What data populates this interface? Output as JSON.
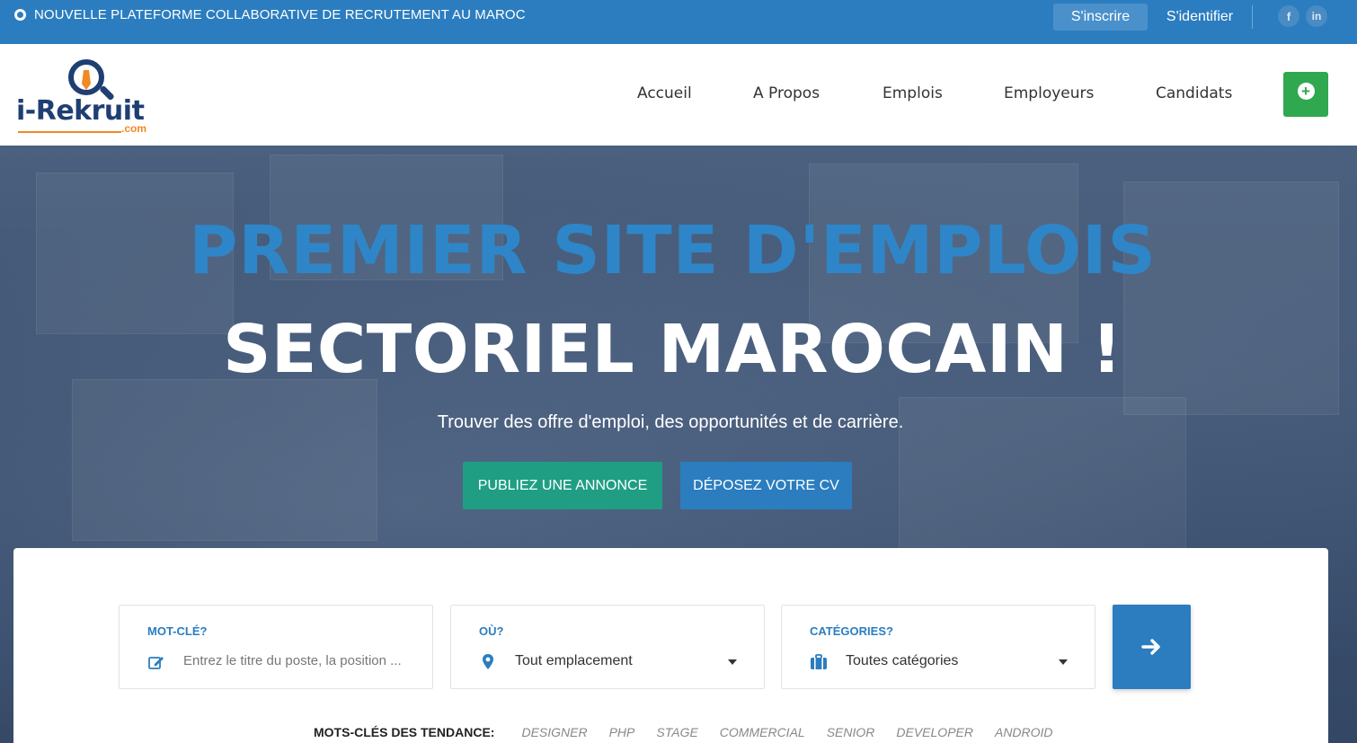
{
  "topbar": {
    "announcement": "NOUVELLE PLATEFORME COLLABORATIVE DE RECRUTEMENT AU MAROC",
    "signup_label": "S'inscrire",
    "login_label": "S'identifier",
    "social": {
      "facebook": "f",
      "linkedin": "in"
    }
  },
  "header": {
    "logo": {
      "name": "i-Rekruit",
      "suffix": ".com"
    },
    "nav": [
      "Accueil",
      "A Propos",
      "Emplois",
      "Employeurs",
      "Candidats"
    ]
  },
  "hero": {
    "title_line1": "PREMIER SITE D'EMPLOIS",
    "title_line2": "SECTORIEL MAROCAIN !",
    "subtitle": "Trouver des offre d'emploi, des opportunités et de carrière.",
    "publish_button": "PUBLIEZ UNE ANNONCE",
    "cv_button": "DÉPOSEZ VOTRE CV"
  },
  "search": {
    "keyword": {
      "label": "MOT-CLÉ?",
      "placeholder": "Entrez le titre du poste, la position ..."
    },
    "location": {
      "label": "OÙ?",
      "selected": "Tout emplacement"
    },
    "category": {
      "label": "CATÉGORIES?",
      "selected": "Toutes catégories"
    }
  },
  "trending": {
    "label": "MOTS-CLÉS DES TENDANCE:",
    "keywords": [
      "DESIGNER",
      "PHP",
      "STAGE",
      "COMMERCIAL",
      "SENIOR",
      "DEVELOPER",
      "ANDROID"
    ]
  },
  "colors": {
    "primary_blue": "#2b7dbf",
    "green_add": "#2fa84f",
    "teal_publish": "#1f9e84",
    "logo_navy": "#1f3f73",
    "logo_orange": "#f08a24"
  }
}
